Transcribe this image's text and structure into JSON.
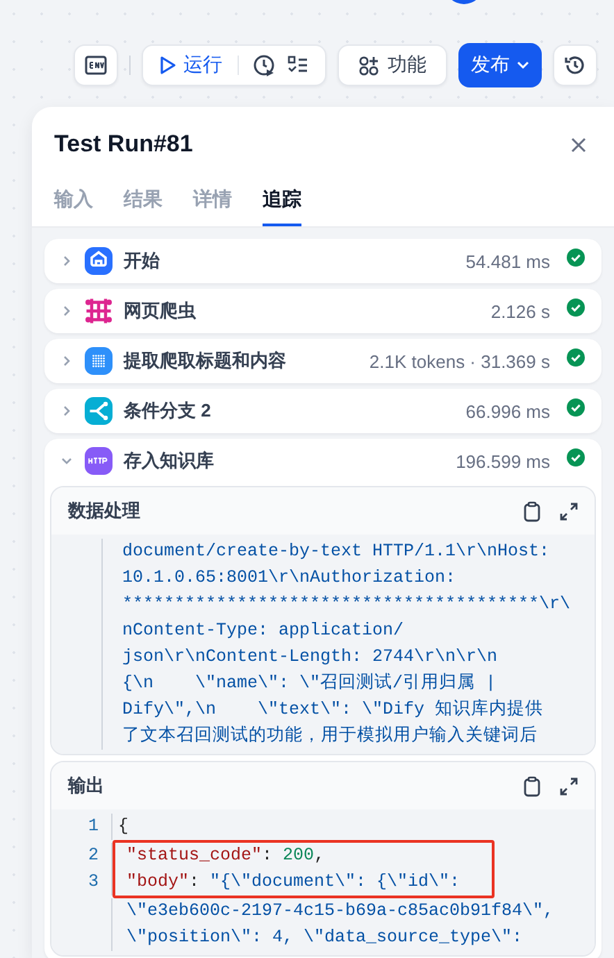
{
  "toolbar": {
    "run_label": "运行",
    "features_label": "功能",
    "publish_label": "发布"
  },
  "panel": {
    "title": "Test Run#81",
    "tabs": [
      {
        "label": "输入",
        "selected": false
      },
      {
        "label": "结果",
        "selected": false
      },
      {
        "label": "详情",
        "selected": false
      },
      {
        "label": "追踪",
        "selected": true
      }
    ]
  },
  "nodes": [
    {
      "kind": "start",
      "name": "开始",
      "meta": "54.481 ms",
      "expanded": false,
      "succeeded": true
    },
    {
      "kind": "crawler",
      "name": "网页爬虫",
      "meta": "2.126 s",
      "expanded": false,
      "succeeded": true
    },
    {
      "kind": "llm",
      "name": "提取爬取标题和内容",
      "meta": "2.1K tokens · 31.369 s",
      "expanded": false,
      "succeeded": true
    },
    {
      "kind": "branch",
      "name": "条件分支 2",
      "meta": "66.996 ms",
      "expanded": false,
      "succeeded": true
    },
    {
      "kind": "http",
      "name": "存入知识库",
      "meta": "196.599 ms",
      "expanded": true,
      "succeeded": true,
      "sections": [
        {
          "kind": "plain",
          "title": "数据处理",
          "lines": [
            {
              "parts": [
                {
                  "kind": "string",
                  "text": "document/create-by-text HTTP/1.1\\r\\nHost:"
                }
              ]
            },
            {
              "parts": [
                {
                  "kind": "string",
                  "text": "10.1.0.65:8001\\r\\nAuthorization:"
                }
              ]
            },
            {
              "parts": [
                {
                  "kind": "string",
                  "text": "****************************************\\r\\"
                }
              ]
            },
            {
              "parts": [
                {
                  "kind": "string",
                  "text": "nContent-Type: application/"
                }
              ]
            },
            {
              "parts": [
                {
                  "kind": "string",
                  "text": "json\\r\\nContent-Length: 2744\\r\\n\\r\\n"
                }
              ]
            },
            {
              "parts": [
                {
                  "kind": "string",
                  "text": "{\\n    \\\"name\\\": \\\"召回测试/引用归属 |"
                }
              ]
            },
            {
              "parts": [
                {
                  "kind": "string",
                  "text": "Dify\\\",\\n    \\\"text\\\": \\\"Dify 知识库内提供"
                }
              ]
            },
            {
              "parts": [
                {
                  "kind": "string",
                  "text": "了文本召回测试的功能，用于模拟用户输入关键词后"
                }
              ]
            }
          ]
        },
        {
          "kind": "numbered",
          "title": "输出",
          "lines": [
            {
              "number": "1",
              "highlighted": false,
              "parts": [
                {
                  "kind": "punct",
                  "text": "{"
                }
              ]
            },
            {
              "number": "2",
              "highlighted": true,
              "parts": [
                {
                  "kind": "key",
                  "text": "\"status_code\""
                },
                {
                  "kind": "punct",
                  "text": ": "
                },
                {
                  "kind": "number",
                  "text": "200"
                },
                {
                  "kind": "punct",
                  "text": ","
                }
              ]
            },
            {
              "number": "3",
              "highlighted": true,
              "parts": [
                {
                  "kind": "key",
                  "text": "\"body\""
                },
                {
                  "kind": "punct",
                  "text": ": "
                },
                {
                  "kind": "string",
                  "text": "\"{\\\"document\\\": {\\\"id\\\":"
                }
              ]
            },
            {
              "highlighted": false,
              "parts": [
                {
                  "kind": "string",
                  "text": "\\\"e3eb600c-2197-4c15-b69a-c85ac0b91f84\\\","
                }
              ]
            },
            {
              "highlighted": false,
              "parts": [
                {
                  "kind": "string",
                  "text": "\\\"position\\\": 4, \\\"data_source_type\\\":"
                }
              ]
            }
          ]
        }
      ]
    }
  ]
}
